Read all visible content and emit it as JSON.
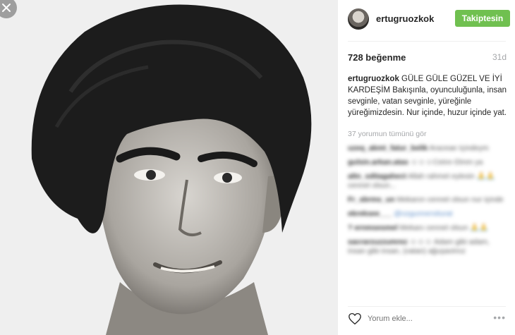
{
  "photo": {
    "alt_icon": "close-icon"
  },
  "header": {
    "username": "ertugruozkok",
    "follow_label": "Takiptesin"
  },
  "stats": {
    "likes": "728 beğenme",
    "time": "31d"
  },
  "caption": {
    "username": "ertugruozkok",
    "text": " GÜLE GÜLE GÜZEL VE İYİ KARDEŞİM Bakışınla, oyunculuğunla, insan sevginle, vatan sevginle, yüreğinle yüreğimizdesin. Nur içinde, huzur içinde yat."
  },
  "view_all": "37 yorumun tümünü gör",
  "comments": [
    {
      "user": "uzeq_akmt_fatur_belik",
      "text": " Araceae Içindeym"
    },
    {
      "user": "gulsin.arkan.atas",
      "text": " ☺☺☺Ceinn Ɛlmm ya"
    },
    {
      "user": "altn_sditagahect",
      "text": " Allah rahmet eylesin 🙏🙏 cennet olsun..."
    },
    {
      "user": "Fr_sbrms_un",
      "text": " Mekanın cennet olsun nur içinde"
    },
    {
      "user": "ekreksee___",
      "text": " @ozgunnersiturat"
    },
    {
      "user": "? ernmsesmel",
      "text": " Mekanı cennet olsun 🙏🙏"
    },
    {
      "user": "sacrarzuzzumrez",
      "text": " ☺☺☺ Adam gibi adam, insan gibi insan, (vatan) ağuşavimız"
    }
  ],
  "footer": {
    "placeholder": "Yorum ekle...",
    "more_label": "•••"
  }
}
